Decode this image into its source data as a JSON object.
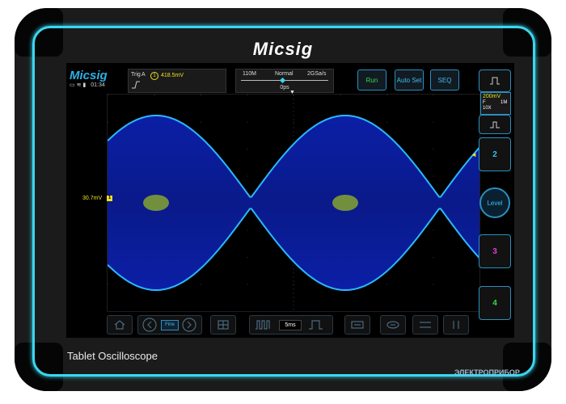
{
  "device": {
    "brand": "Micsig",
    "caption": "Tablet Oscilloscope"
  },
  "status": {
    "logo": "Micsig",
    "time": "01:34"
  },
  "trigger": {
    "label": "Trig",
    "source": "A",
    "level": "418.5mV"
  },
  "acquisition": {
    "memory_depth": "110M",
    "mode": "Normal",
    "sample_rate": "2GSa/s",
    "delay": "0ps"
  },
  "top_buttons": {
    "run": "Run",
    "auto_set": "Auto Set",
    "seq": "SEQ"
  },
  "channel1": {
    "offset": "30.7mV",
    "marker": "1",
    "scale": "200mV",
    "coupling": "F",
    "impedance": "1M",
    "probe": "10X"
  },
  "right_column": {
    "ch2": "2",
    "level": "Level",
    "ch3": "3",
    "ch4": "4"
  },
  "bottom_toolbar": {
    "fine": "Fine",
    "timebase": "5ms"
  },
  "watermark": "ЭЛЕКТРОПРИБОР",
  "colors": {
    "accent": "#3ad7f0",
    "ch1": "#f0e020",
    "ch2": "#39c0f0",
    "ch3": "#e040d0",
    "ch4": "#39d94a",
    "run": "#39d94a"
  }
}
